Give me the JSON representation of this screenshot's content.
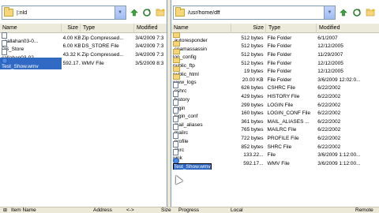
{
  "left": {
    "path": "|:nld",
    "columns": [
      "Name",
      "Size",
      "Type",
      "Modified"
    ],
    "files": [
      {
        "name": "_callahan03-0...",
        "size": "4.00 KB",
        "type": "Zip Compressed...",
        "modified": "3/4/2009 7:3",
        "icon": "file-icon"
      },
      {
        "name": "DS_Store",
        "size": "6.00 KB",
        "type": "DS_STORE File",
        "modified": "3/4/2009 7:3",
        "icon": "file-icon"
      },
      {
        "name": "callahan03-02-...",
        "size": "43.32 KB",
        "type": "Zip Compressed...",
        "modified": "3/4/2009 7:3",
        "icon": "file-icon"
      },
      {
        "name": "Test_Show.wmv",
        "size": "592.17...",
        "type": "WMV File",
        "modified": "3/5/2009 8:3",
        "icon": "wmv-icon",
        "selected": true
      }
    ]
  },
  "right": {
    "path": "/usr/home/dff",
    "columns": [
      "Name",
      "Size",
      "Type",
      "Modified"
    ],
    "files": [
      {
        "name": ".autoresponder",
        "size": "512 bytes",
        "type": "File Folder",
        "modified": "6/1/2007",
        "icon": "folder-icon"
      },
      {
        "name": ".spamassassin",
        "size": "512 bytes",
        "type": "File Folder",
        "modified": "12/12/2005",
        "icon": "folder-icon"
      },
      {
        "name": "log_config",
        "size": "512 bytes",
        "type": "File Folder",
        "modified": "11/29/2007",
        "icon": "folder-icon"
      },
      {
        "name": "public_ftp",
        "size": "512 bytes",
        "type": "File Folder",
        "modified": "12/12/2005",
        "icon": "folder-icon"
      },
      {
        "name": "public_html",
        "size": "19 bytes",
        "type": "File Folder",
        "modified": "12/12/2005",
        "icon": "folder-icon"
      },
      {
        "name": "www_logs",
        "size": "20.00 KB",
        "type": "File Folder",
        "modified": "3/6/2009 12:02:0...",
        "icon": "folder-icon"
      },
      {
        "name": ".cshrc",
        "size": "626 bytes",
        "type": "CSHRC File",
        "modified": "6/22/2002",
        "icon": "file-icon"
      },
      {
        "name": ".history",
        "size": "429 bytes",
        "type": "HISTORY File",
        "modified": "6/22/2002",
        "icon": "file-icon"
      },
      {
        "name": ".login",
        "size": "299 bytes",
        "type": "LOGIN File",
        "modified": "6/22/2002",
        "icon": "file-icon"
      },
      {
        "name": ".login_conf",
        "size": "160 bytes",
        "type": "LOGIN_CONF File",
        "modified": "6/22/2002",
        "icon": "file-icon"
      },
      {
        "name": ".mail_aliases",
        "size": "361 bytes",
        "type": "MAIL_ALIASES ...",
        "modified": "6/22/2002",
        "icon": "file-icon"
      },
      {
        "name": ".mailrc",
        "size": "765 bytes",
        "type": "MAILRC File",
        "modified": "6/22/2002",
        "icon": "file-icon"
      },
      {
        "name": ".profile",
        "size": "722 bytes",
        "type": "PROFILE File",
        "modified": "6/22/2002",
        "icon": "file-icon"
      },
      {
        "name": ".shrc",
        "size": "852 bytes",
        "type": "SHRC File",
        "modified": "6/22/2002",
        "icon": "file-icon"
      },
      {
        "name": "junk",
        "size": "133.22...",
        "type": "File",
        "modified": "3/6/2009 1:12:00...",
        "icon": "file-icon"
      },
      {
        "name": "Test_Show.wmv",
        "size": "592.17...",
        "type": "WMV File",
        "modified": "3/6/2009 1:12:00...",
        "icon": "wmv-icon",
        "renaming": true
      }
    ]
  },
  "queue": {
    "columns": [
      "Item Name",
      "Address",
      "<->",
      "Size",
      "Progress",
      "Local",
      "Remote"
    ]
  },
  "colors": {
    "selection": "#316ac5",
    "window_bg": "#ece9d8",
    "header_bg": "#ebeadb",
    "border": "#7f9db9",
    "folder": "#f5d77a"
  },
  "toolbar_icons": [
    "up-arrow-icon",
    "refresh-icon",
    "new-folder-icon"
  ]
}
